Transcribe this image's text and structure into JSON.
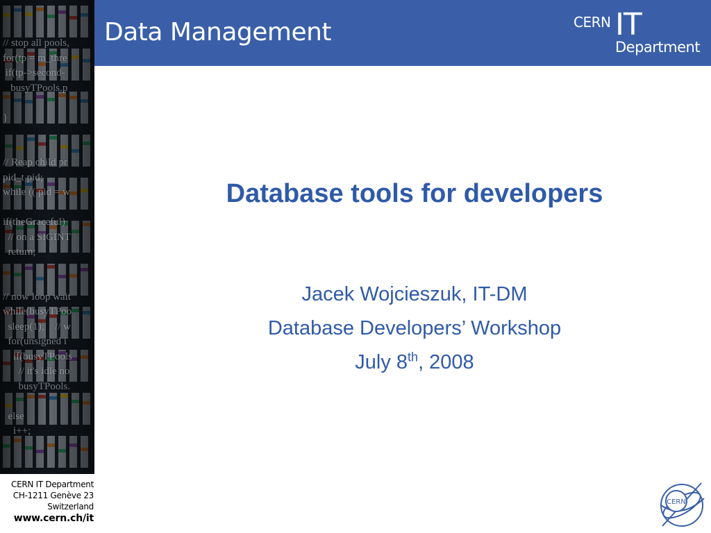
{
  "header": {
    "title": "Data Management",
    "logo_cern": "CERN",
    "logo_it": "IT",
    "logo_department": "Department"
  },
  "side_strip": {
    "code_lines": [
      "// stop all pools,",
      "for(tp = m_thre",
      " if(tp->second-",
      "   busyTPools.p",
      "",
      "}",
      "",
      "",
      "// Reap child pr",
      "pid_t pid;",
      "while (( pid = w",
      "",
      "if(theGraceful)",
      "  // on a SIGINT",
      "  return;",
      "",
      "",
      "// now loop wait",
      "while(busyTPoo",
      "  sleep(1);    // w",
      "  for(unsigned i",
      "    if(busyTPools",
      "      // it's idle no",
      "      busyTPools.",
      "",
      "  else",
      "    i++;"
    ]
  },
  "slide": {
    "title": "Database tools for developers",
    "author": "Jacek Wojcieszuk, IT-DM",
    "event": "Database Developers’ Workshop",
    "date_prefix": "July 8",
    "date_sup": "th",
    "date_suffix": ", 2008"
  },
  "footer": {
    "line1": "CERN IT Department",
    "line2": "CH-1211 Genève 23",
    "line3": "Switzerland",
    "url": "www.cern.ch/it"
  },
  "seal": {
    "text": "CERN"
  },
  "colors": {
    "header_bg": "#3a5fa8",
    "title_blue": "#2f5aa8"
  }
}
